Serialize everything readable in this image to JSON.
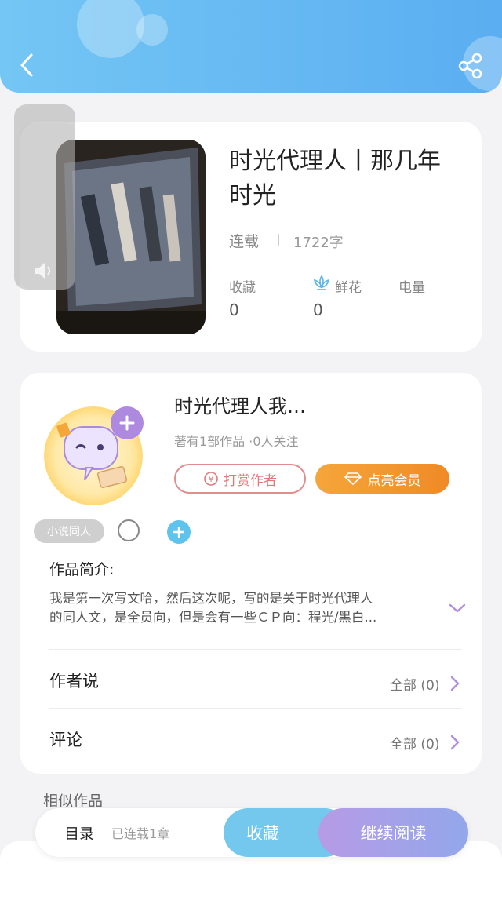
{
  "header": {
    "back_icon": "chevron-left-icon",
    "share_icon": "share-icon"
  },
  "book": {
    "title": "时光代理人丨那几年时光",
    "status": "连载",
    "word_count": "1722字",
    "stats": [
      {
        "label": "收藏",
        "value": "0"
      },
      {
        "label": "鲜花",
        "value": "0",
        "icon": "flower-icon"
      },
      {
        "label": "电量",
        "value": ""
      }
    ]
  },
  "author": {
    "name": "时光代理人我…",
    "meta": "著有1部作品 ·0人关注",
    "tip_button": "打赏作者",
    "vip_button": "点亮会员",
    "tag": "小说同人"
  },
  "intro": {
    "heading": "作品简介:",
    "text_line1": "我是第一次写文哈，然后这次呢，写的是关于时光代理人",
    "text_line2": "的同人文，是全员向，但是会有一些ＣＰ向：程光/黑白..."
  },
  "sections": [
    {
      "label": "作者说",
      "right": "全部 (0)"
    },
    {
      "label": "评论",
      "right": "全部 (0)"
    }
  ],
  "similar": {
    "heading": "相似作品"
  },
  "bottom_bar": {
    "catalog": "目录",
    "chapters": "已连载1章",
    "collect": "收藏",
    "continue": "继续阅读"
  },
  "colors": {
    "accent_blue": "#5aaef1",
    "vip_orange": "#f29a2e",
    "purple": "#b08ee3"
  }
}
